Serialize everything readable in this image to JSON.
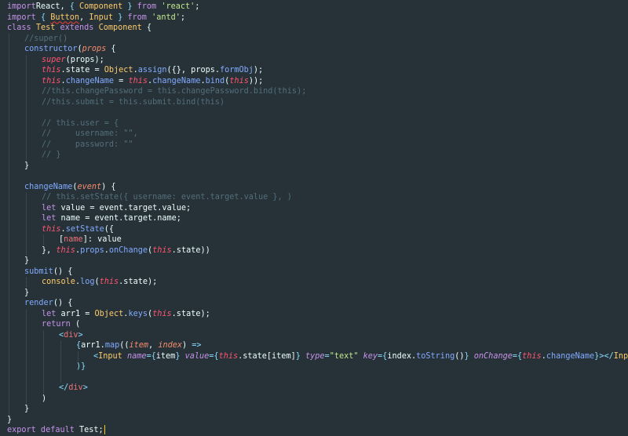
{
  "editor": {
    "colors": {
      "background": "#263238",
      "keyword": "#c792ea",
      "class_name": "#ffcb6b",
      "string": "#c3e88d",
      "comment": "#546e7a",
      "function": "#82aaff",
      "this": "#ff5370",
      "param": "#f78c6c",
      "punctuation": "#89ddff",
      "text": "#eeffff"
    },
    "lines": [
      {
        "indent": 0,
        "tokens": [
          [
            "kw",
            "import"
          ],
          [
            "",
            "React, "
          ],
          [
            "pun",
            "{ "
          ],
          [
            "ident",
            "Component"
          ],
          [
            "pun",
            " }"
          ],
          [
            "kw",
            " from "
          ],
          [
            "str",
            "'react'"
          ],
          [
            "",
            "; "
          ]
        ]
      },
      {
        "indent": 0,
        "tokens": [
          [
            "kw",
            "import"
          ],
          [
            "pun",
            " { "
          ],
          [
            "ident err",
            "Button"
          ],
          [
            "",
            ", "
          ],
          [
            "ident",
            "Input"
          ],
          [
            "pun",
            " }"
          ],
          [
            "kw",
            " from "
          ],
          [
            "str",
            "'antd'"
          ],
          [
            "",
            ";"
          ]
        ]
      },
      {
        "indent": 0,
        "tokens": [
          [
            "kw",
            "class "
          ],
          [
            "ident",
            "Test"
          ],
          [
            "kw",
            " extends "
          ],
          [
            "ident",
            "Component"
          ],
          [
            "",
            " {"
          ]
        ]
      },
      {
        "indent": 1,
        "tokens": [
          [
            "cmt",
            "//super()"
          ]
        ]
      },
      {
        "indent": 1,
        "tokens": [
          [
            "fn",
            "constructor"
          ],
          [
            "",
            "("
          ],
          [
            "param",
            "props"
          ],
          [
            "",
            " {"
          ]
        ]
      },
      {
        "indent": 2,
        "tokens": [
          [
            "this",
            "super"
          ],
          [
            "",
            "(props);"
          ]
        ]
      },
      {
        "indent": 2,
        "tokens": [
          [
            "this",
            "this"
          ],
          [
            "",
            ".state = "
          ],
          [
            "ident",
            "Object"
          ],
          [
            "",
            "."
          ],
          [
            "fn",
            "assign"
          ],
          [
            "",
            "({}, props."
          ],
          [
            "fn",
            "formObj"
          ],
          [
            "",
            ");"
          ]
        ]
      },
      {
        "indent": 2,
        "tokens": [
          [
            "this",
            "this"
          ],
          [
            "",
            "."
          ],
          [
            "fn",
            "changeName"
          ],
          [
            "",
            " = "
          ],
          [
            "this",
            "this"
          ],
          [
            "",
            "."
          ],
          [
            "fn",
            "changeName"
          ],
          [
            "",
            "."
          ],
          [
            "fn",
            "bind"
          ],
          [
            "",
            "("
          ],
          [
            "this",
            "this"
          ],
          [
            "",
            "));"
          ]
        ]
      },
      {
        "indent": 2,
        "tokens": [
          [
            "cmt",
            "//this.changePassword = this.changePassword.bind(this);"
          ]
        ]
      },
      {
        "indent": 2,
        "tokens": [
          [
            "cmt",
            "//this.submit = this.submit.bind(this)"
          ]
        ]
      },
      {
        "indent": 2,
        "tokens": []
      },
      {
        "indent": 2,
        "tokens": [
          [
            "cmt",
            "// this.user = {"
          ]
        ]
      },
      {
        "indent": 2,
        "tokens": [
          [
            "cmt",
            "//     username: \"\","
          ]
        ]
      },
      {
        "indent": 2,
        "tokens": [
          [
            "cmt",
            "//     password: \"\""
          ]
        ]
      },
      {
        "indent": 2,
        "tokens": [
          [
            "cmt",
            "// }"
          ]
        ]
      },
      {
        "indent": 1,
        "tokens": [
          [
            "",
            "}"
          ]
        ]
      },
      {
        "indent": 1,
        "tokens": []
      },
      {
        "indent": 1,
        "tokens": [
          [
            "fn",
            "changeName"
          ],
          [
            "",
            "("
          ],
          [
            "param",
            "event"
          ],
          [
            "",
            ") {"
          ]
        ]
      },
      {
        "indent": 2,
        "tokens": [
          [
            "cmt",
            "// this.setState({ username: event.target.value }, )"
          ]
        ]
      },
      {
        "indent": 2,
        "tokens": [
          [
            "kw",
            "let "
          ],
          [
            "",
            "value = event.target.value;"
          ]
        ]
      },
      {
        "indent": 2,
        "tokens": [
          [
            "kw",
            "let "
          ],
          [
            "",
            "name = event.target.name;"
          ]
        ]
      },
      {
        "indent": 2,
        "tokens": [
          [
            "this",
            "this"
          ],
          [
            "",
            "."
          ],
          [
            "fn",
            "setState"
          ],
          [
            "",
            "({"
          ]
        ]
      },
      {
        "indent": 3,
        "tokens": [
          [
            "",
            "["
          ],
          [
            "prop",
            "name"
          ],
          [
            "",
            "]: value"
          ]
        ]
      },
      {
        "indent": 2,
        "tokens": [
          [
            "",
            "}, "
          ],
          [
            "this",
            "this"
          ],
          [
            "",
            "."
          ],
          [
            "fn",
            "props"
          ],
          [
            "",
            "."
          ],
          [
            "fn",
            "onChange"
          ],
          [
            "",
            "("
          ],
          [
            "this",
            "this"
          ],
          [
            "",
            ".state))"
          ]
        ]
      },
      {
        "indent": 1,
        "tokens": [
          [
            "",
            "}"
          ]
        ]
      },
      {
        "indent": 1,
        "tokens": [
          [
            "fn",
            "submit"
          ],
          [
            "",
            "() {"
          ]
        ]
      },
      {
        "indent": 2,
        "tokens": [
          [
            "ident",
            "console"
          ],
          [
            "",
            "."
          ],
          [
            "fn",
            "log"
          ],
          [
            "",
            "("
          ],
          [
            "this",
            "this"
          ],
          [
            "",
            ".state);"
          ]
        ]
      },
      {
        "indent": 1,
        "tokens": [
          [
            "",
            "}"
          ]
        ]
      },
      {
        "indent": 1,
        "tokens": [
          [
            "fn",
            "render"
          ],
          [
            "",
            "() {"
          ]
        ]
      },
      {
        "indent": 2,
        "tokens": [
          [
            "kw",
            "let "
          ],
          [
            "",
            "arr1 = "
          ],
          [
            "ident",
            "Object"
          ],
          [
            "",
            "."
          ],
          [
            "fn",
            "keys"
          ],
          [
            "",
            "("
          ],
          [
            "this",
            "this"
          ],
          [
            "",
            ".state);"
          ]
        ]
      },
      {
        "indent": 2,
        "tokens": [
          [
            "kw",
            "return"
          ],
          [
            "",
            " ("
          ]
        ]
      },
      {
        "indent": 3,
        "tokens": [
          [
            "pun",
            "<"
          ],
          [
            "prop",
            "div"
          ],
          [
            "pun",
            ">"
          ]
        ]
      },
      {
        "indent": 4,
        "tokens": [
          [
            "pun",
            "{"
          ],
          [
            "",
            "arr1."
          ],
          [
            "fn",
            "map"
          ],
          [
            "",
            "(("
          ],
          [
            "param",
            "item"
          ],
          [
            "",
            ", "
          ],
          [
            "param",
            "index"
          ],
          [
            "",
            ") "
          ],
          [
            "pun",
            "=>"
          ]
        ]
      },
      {
        "indent": 5,
        "tokens": [
          [
            "pun",
            "<"
          ],
          [
            "ident",
            "Input"
          ],
          [
            " ",
            " "
          ],
          [
            "attr",
            "name"
          ],
          [
            "pun",
            "={"
          ],
          [
            "",
            "item"
          ],
          [
            "pun",
            "}"
          ],
          [
            "",
            " "
          ],
          [
            "attr",
            "value"
          ],
          [
            "pun",
            "={"
          ],
          [
            "this",
            "this"
          ],
          [
            "",
            ".state[item]"
          ],
          [
            "pun",
            "}"
          ],
          [
            "",
            " "
          ],
          [
            "attr",
            "type"
          ],
          [
            "pun",
            "="
          ],
          [
            "str",
            "\"text\""
          ],
          [
            "",
            " "
          ],
          [
            "attr",
            "key"
          ],
          [
            "pun",
            "={"
          ],
          [
            "",
            "index."
          ],
          [
            "fn",
            "toString"
          ],
          [
            "",
            "()"
          ],
          [
            "pun",
            "}"
          ],
          [
            "",
            " "
          ],
          [
            "attr",
            "onChange"
          ],
          [
            "pun",
            "={"
          ],
          [
            "this",
            "this"
          ],
          [
            "",
            "."
          ],
          [
            "fn",
            "changeName"
          ],
          [
            "pun",
            "}"
          ],
          [
            "pun",
            ">"
          ],
          [
            "pun",
            "</"
          ],
          [
            "ident",
            "Input"
          ],
          [
            "pun",
            ">"
          ]
        ]
      },
      {
        "indent": 4,
        "tokens": [
          [
            "pun",
            ")}"
          ]
        ]
      },
      {
        "indent": 4,
        "tokens": []
      },
      {
        "indent": 3,
        "tokens": [
          [
            "pun",
            "</"
          ],
          [
            "prop",
            "div"
          ],
          [
            "pun",
            ">"
          ]
        ]
      },
      {
        "indent": 2,
        "tokens": [
          [
            "",
            ")"
          ]
        ]
      },
      {
        "indent": 1,
        "tokens": [
          [
            "",
            "}"
          ]
        ]
      },
      {
        "indent": 0,
        "tokens": [
          [
            "",
            "}"
          ]
        ]
      },
      {
        "indent": 0,
        "tokens": [
          [
            "kw",
            "export default "
          ],
          [
            "",
            "Test;"
          ]
        ],
        "cursor": true
      }
    ]
  }
}
